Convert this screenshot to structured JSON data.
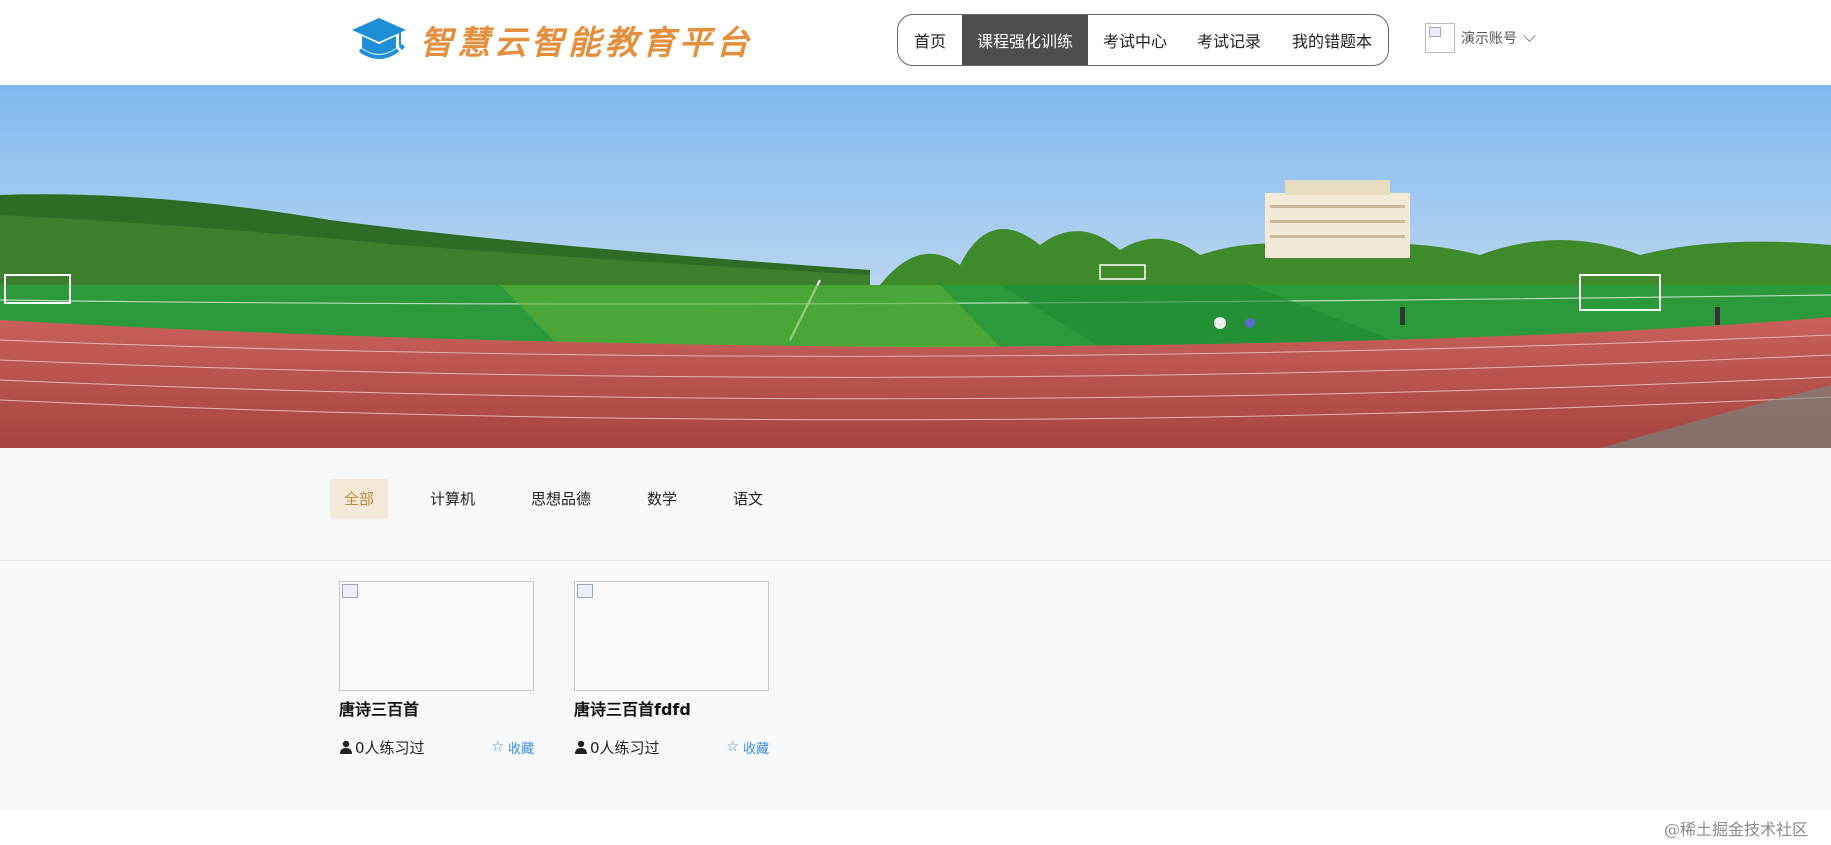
{
  "header": {
    "logo_text": "智慧云智能教育平台",
    "nav": [
      {
        "label": "首页",
        "active": false
      },
      {
        "label": "课程强化训练",
        "active": true
      },
      {
        "label": "考试中心",
        "active": false
      },
      {
        "label": "考试记录",
        "active": false
      },
      {
        "label": "我的错题本",
        "active": false
      }
    ],
    "account_name": "演示账号"
  },
  "categories": [
    {
      "label": "全部",
      "active": true
    },
    {
      "label": "计算机",
      "active": false
    },
    {
      "label": "思想品德",
      "active": false
    },
    {
      "label": "数学",
      "active": false
    },
    {
      "label": "语文",
      "active": false
    }
  ],
  "courses": [
    {
      "title": "唐诗三百首",
      "practice": "0人练习过",
      "favorite": "收藏"
    },
    {
      "title": "唐诗三百首fdfd",
      "practice": "0人练习过",
      "favorite": "收藏"
    }
  ],
  "watermark": "@稀土掘金技术社区",
  "colors": {
    "nav_active_bg": "#4d4d4d",
    "category_active_bg": "#f5ead9",
    "category_active_text": "#c08a3e",
    "favorite_blue": "#3d8fe0",
    "logo_orange": "#e58f3d",
    "logo_blue": "#1e8fd6"
  }
}
